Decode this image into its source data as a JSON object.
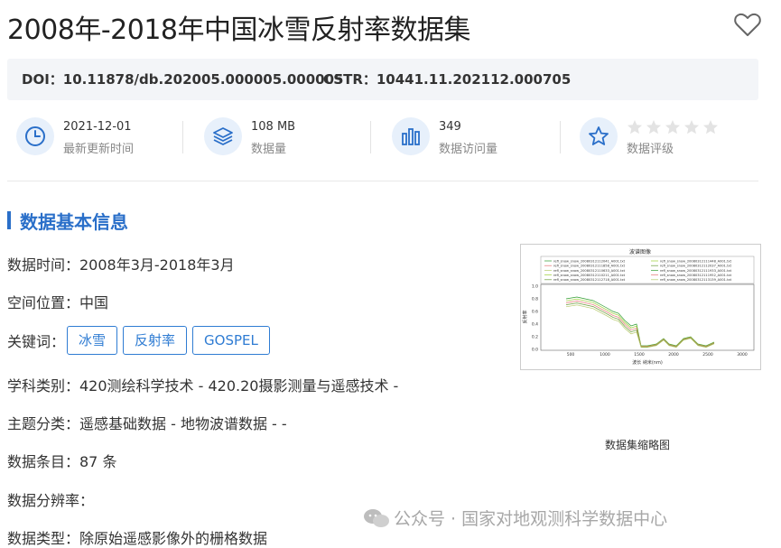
{
  "title": "2008年-2018年中国冰雪反射率数据集",
  "doi": "DOI：10.11878/db.202005.000005.000005",
  "cstr": "CSTR：10441.11.202112.000705",
  "stats": {
    "update": {
      "value": "2021-12-01",
      "label": "最新更新时间",
      "icon": "clock-icon"
    },
    "size": {
      "value": "108 MB",
      "label": "数据量",
      "icon": "layers-icon"
    },
    "visits": {
      "value": "349",
      "label": "数据访问量",
      "icon": "bar-chart-icon"
    },
    "rating": {
      "label": "数据评级",
      "stars": 0,
      "max_stars": 5,
      "icon": "star-icon"
    }
  },
  "section_title": "数据基本信息",
  "info": {
    "time": "数据时间：2008年3月-2018年3月",
    "location": "空间位置：中国",
    "keywords_label": "关键词：",
    "keywords": [
      "冰雪",
      "反射率",
      "GOSPEL"
    ],
    "subject": "学科类别：420测绘科学技术 - 420.20摄影测量与遥感技术 -",
    "theme": "主题分类：遥感基础数据 - 地物波谱数据 - -",
    "count": "数据条目：87 条",
    "resolution": "数据分辨率：",
    "type": "数据类型：除原始遥感影像外的栅格数据"
  },
  "thumbnail": {
    "caption": "数据集缩略图",
    "chart_title": "波谱图像",
    "ylabel": "反射率",
    "xlabel": "波长 纳米(nm)",
    "legend": [
      "refl_snow_snow_20080312112041_A001.txt",
      "refl_snow_snow_20080312111448_A001.txt",
      "refl_snow_snow_20080312111858_A001.txt",
      "refl_snow_snow_20080312112037_A001.txt",
      "refl_snow_snow_20080312110633_A001.txt",
      "refl_snow_snow_20080312111933_A001.txt",
      "refl_snow_snow_20080312110211_A001.txt",
      "refl_snow_snow_20080312111952_A001.txt",
      "refl_snow_snow_20080312112718_A001.txt",
      "refl_snow_snow_20080312113139_A001.txt"
    ],
    "yticks": [
      "1.0",
      "0.8",
      "0.6",
      "0.4",
      "0.2",
      "0.0"
    ],
    "xticks": [
      "500",
      "1000",
      "1500",
      "2000",
      "2500",
      "3000"
    ],
    "colors": [
      "#2e9d2e",
      "#9acd32",
      "#e57373",
      "#6a9c3a",
      "#b5c96a"
    ]
  },
  "watermark": "公众号 · 国家对地观测科学数据中心"
}
